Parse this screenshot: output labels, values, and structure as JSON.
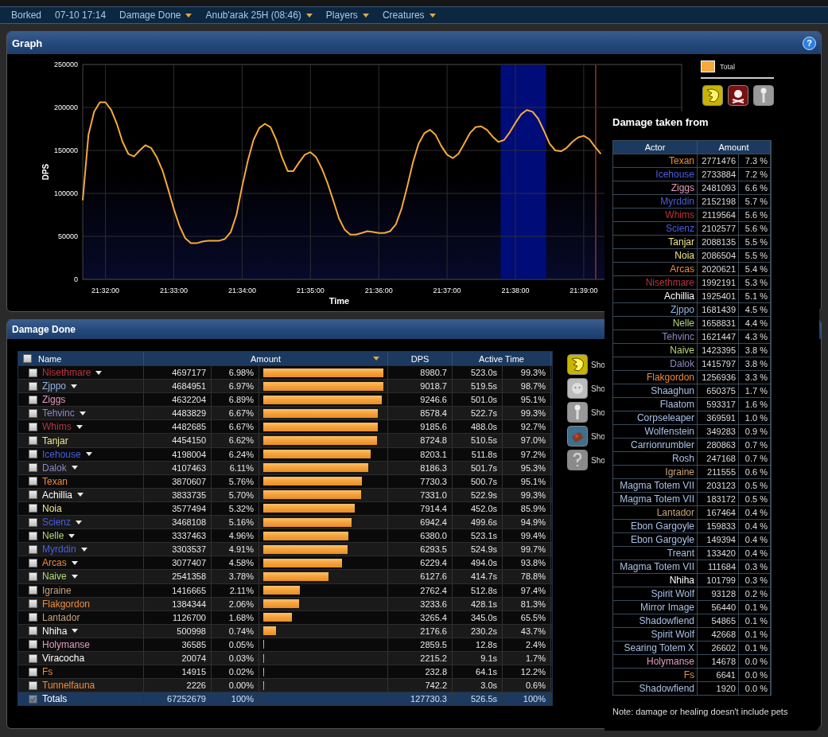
{
  "top_bar": {
    "items": [
      {
        "label": "Borked",
        "menu": false
      },
      {
        "label": "07-10 17:14",
        "menu": false
      },
      {
        "label": "Damage Done",
        "menu": true
      },
      {
        "label": "Anub'arak 25H (08:46)",
        "menu": true
      },
      {
        "label": "Players",
        "menu": true
      },
      {
        "label": "Creatures",
        "menu": true
      }
    ]
  },
  "graph_panel": {
    "title": "Graph",
    "help": "?",
    "chart_data": {
      "type": "line",
      "xlabel": "Time",
      "ylabel": "DPS",
      "ylim": [
        0,
        250000
      ],
      "yticks": [
        0,
        50000,
        100000,
        150000,
        200000,
        250000
      ],
      "categories": [
        null,
        null,
        null,
        null,
        "21:32:00",
        null,
        null,
        null,
        null,
        null,
        null,
        null,
        null,
        null,
        null,
        null,
        "21:33:00",
        null,
        null,
        null,
        null,
        null,
        null,
        null,
        null,
        null,
        null,
        null,
        "21:34:00",
        null,
        null,
        null,
        null,
        null,
        null,
        null,
        null,
        null,
        null,
        null,
        "21:35:00",
        null,
        null,
        null,
        null,
        null,
        null,
        null,
        null,
        null,
        null,
        null,
        "21:36:00",
        null,
        null,
        null,
        null,
        null,
        null,
        null,
        null,
        null,
        null,
        null,
        "21:37:00",
        null,
        null,
        null,
        null,
        null,
        null,
        null,
        null,
        null,
        null,
        null,
        "21:38:00",
        null,
        null,
        null,
        null,
        null,
        null,
        null,
        null,
        null,
        null,
        null,
        "21:39:00",
        null,
        null,
        null
      ],
      "series": [
        {
          "name": "Total",
          "color": "#f5a93a",
          "values": [
            92000,
            168000,
            195000,
            206000,
            206000,
            197000,
            181000,
            160000,
            146000,
            143000,
            150000,
            156000,
            153000,
            142000,
            127000,
            105000,
            82000,
            62000,
            48000,
            42000,
            42000,
            44000,
            45000,
            45000,
            45000,
            47000,
            55000,
            75000,
            108000,
            138000,
            162000,
            176000,
            181000,
            177000,
            162000,
            142000,
            126000,
            126000,
            136000,
            145000,
            148000,
            142000,
            129000,
            112000,
            92000,
            71000,
            58000,
            52000,
            52000,
            54000,
            56000,
            55000,
            54000,
            54000,
            56000,
            64000,
            82000,
            108000,
            136000,
            158000,
            170000,
            174000,
            168000,
            155000,
            145000,
            141000,
            146000,
            158000,
            170000,
            177000,
            178000,
            174000,
            166000,
            160000,
            162000,
            171000,
            182000,
            192000,
            197000,
            195000,
            187000,
            173000,
            158000,
            150000,
            149000,
            153000,
            160000,
            165000,
            167000,
            163000,
            154000,
            146000
          ]
        }
      ],
      "grid": true
    }
  },
  "damage_panel": {
    "title": "Damage Done",
    "table": {
      "columns": [
        "Name",
        "Amount",
        "DPS",
        "Active Time"
      ],
      "select_all": {
        "checked": false
      },
      "rows": [
        {
          "name": "Nisethmare",
          "color": "#b8333f",
          "menu": true,
          "checked": false,
          "amount": "4697177",
          "percent": "6.98%",
          "level": 1.0,
          "dps": "8980.7",
          "time": "523.0s",
          "active": "99.3%"
        },
        {
          "name": "Zjppo",
          "color": "#8fb5e8",
          "menu": true,
          "checked": false,
          "amount": "4684951",
          "percent": "6.97%",
          "level": 0.997,
          "dps": "9018.7",
          "time": "519.5s",
          "active": "98.7%"
        },
        {
          "name": "Ziggs",
          "color": "#e39bc0",
          "menu": false,
          "checked": false,
          "amount": "4632204",
          "percent": "6.89%",
          "level": 0.986,
          "dps": "9246.6",
          "time": "501.0s",
          "active": "95.1%"
        },
        {
          "name": "Tehvinc",
          "color": "#8e88c4",
          "menu": true,
          "checked": false,
          "amount": "4483829",
          "percent": "6.67%",
          "level": 0.955,
          "dps": "8578.4",
          "time": "522.7s",
          "active": "99.3%"
        },
        {
          "name": "Whims",
          "color": "#b8333f",
          "menu": true,
          "checked": false,
          "amount": "4482685",
          "percent": "6.67%",
          "level": 0.954,
          "dps": "9185.6",
          "time": "488.0s",
          "active": "92.7%"
        },
        {
          "name": "Tanjar",
          "color": "#f0e68c",
          "menu": false,
          "checked": false,
          "amount": "4454150",
          "percent": "6.62%",
          "level": 0.948,
          "dps": "8724.8",
          "time": "510.5s",
          "active": "97.0%"
        },
        {
          "name": "Icehouse",
          "color": "#4a5fe0",
          "menu": true,
          "checked": false,
          "amount": "4198004",
          "percent": "6.24%",
          "level": 0.894,
          "dps": "8203.1",
          "time": "511.8s",
          "active": "97.2%"
        },
        {
          "name": "Dalok",
          "color": "#8e88c4",
          "menu": true,
          "checked": false,
          "amount": "4107463",
          "percent": "6.11%",
          "level": 0.874,
          "dps": "8186.3",
          "time": "501.7s",
          "active": "95.3%"
        },
        {
          "name": "Texan",
          "color": "#f08a3c",
          "menu": false,
          "checked": false,
          "amount": "3870607",
          "percent": "5.76%",
          "level": 0.824,
          "dps": "7730.3",
          "time": "500.7s",
          "active": "95.1%"
        },
        {
          "name": "Achillia",
          "color": "#ffffff",
          "menu": true,
          "checked": false,
          "amount": "3833735",
          "percent": "5.70%",
          "level": 0.816,
          "dps": "7331.0",
          "time": "522.9s",
          "active": "99.3%"
        },
        {
          "name": "Noia",
          "color": "#f0e68c",
          "menu": false,
          "checked": false,
          "amount": "3577494",
          "percent": "5.32%",
          "level": 0.762,
          "dps": "7914.4",
          "time": "452.0s",
          "active": "85.9%"
        },
        {
          "name": "Scienz",
          "color": "#4a5fe0",
          "menu": true,
          "checked": false,
          "amount": "3468108",
          "percent": "5.16%",
          "level": 0.738,
          "dps": "6942.4",
          "time": "499.6s",
          "active": "94.9%"
        },
        {
          "name": "Nelle",
          "color": "#b5d67a",
          "menu": true,
          "checked": false,
          "amount": "3337463",
          "percent": "4.96%",
          "level": 0.711,
          "dps": "6380.0",
          "time": "523.1s",
          "active": "99.4%"
        },
        {
          "name": "Myrddin",
          "color": "#4a5fe0",
          "menu": true,
          "checked": false,
          "amount": "3303537",
          "percent": "4.91%",
          "level": 0.703,
          "dps": "6293.5",
          "time": "524.9s",
          "active": "99.7%"
        },
        {
          "name": "Arcas",
          "color": "#f08a3c",
          "menu": true,
          "checked": false,
          "amount": "3077407",
          "percent": "4.58%",
          "level": 0.655,
          "dps": "6229.4",
          "time": "494.0s",
          "active": "93.8%"
        },
        {
          "name": "Naive",
          "color": "#b5d67a",
          "menu": true,
          "checked": false,
          "amount": "2541358",
          "percent": "3.78%",
          "level": 0.541,
          "dps": "6127.6",
          "time": "414.7s",
          "active": "78.8%"
        },
        {
          "name": "Igraine",
          "color": "#c9a37a",
          "menu": false,
          "checked": false,
          "amount": "1416665",
          "percent": "2.11%",
          "level": 0.302,
          "dps": "2762.4",
          "time": "512.8s",
          "active": "97.4%"
        },
        {
          "name": "Flakgordon",
          "color": "#f08a3c",
          "menu": false,
          "checked": false,
          "amount": "1384344",
          "percent": "2.06%",
          "level": 0.295,
          "dps": "3233.6",
          "time": "428.1s",
          "active": "81.3%"
        },
        {
          "name": "Lantador",
          "color": "#c9a37a",
          "menu": false,
          "checked": false,
          "amount": "1126700",
          "percent": "1.68%",
          "level": 0.24,
          "dps": "3265.4",
          "time": "345.0s",
          "active": "65.5%"
        },
        {
          "name": "Nhiha",
          "color": "#ffffff",
          "menu": true,
          "checked": false,
          "amount": "500998",
          "percent": "0.74%",
          "level": 0.107,
          "dps": "2176.6",
          "time": "230.2s",
          "active": "43.7%"
        },
        {
          "name": "Holymanse",
          "color": "#e39bc0",
          "menu": false,
          "checked": false,
          "amount": "36585",
          "percent": "0.05%",
          "level": 0.008,
          "dps": "2859.5",
          "time": "12.8s",
          "active": "2.4%"
        },
        {
          "name": "Viracocha",
          "color": "#ffffff",
          "menu": false,
          "checked": false,
          "amount": "20074",
          "percent": "0.03%",
          "level": 0.004,
          "dps": "2215.2",
          "time": "9.1s",
          "active": "1.7%"
        },
        {
          "name": "Fs",
          "color": "#f08a3c",
          "menu": false,
          "checked": false,
          "amount": "14915",
          "percent": "0.02%",
          "level": 0.003,
          "dps": "232.8",
          "time": "64.1s",
          "active": "12.2%"
        },
        {
          "name": "Tunnelfauna",
          "color": "#f08a3c",
          "menu": false,
          "checked": false,
          "amount": "2226",
          "percent": "0.00%",
          "level": 0.001,
          "dps": "742.2",
          "time": "3.0s",
          "active": "0.6%"
        }
      ],
      "totals": {
        "name": "Totals",
        "checked": true,
        "amount": "67252679",
        "percent": "100%",
        "dps": "127730.3",
        "time": "526.5s",
        "active": "100%"
      }
    },
    "filters": [
      {
        "kind": "claw",
        "label": "Sho"
      },
      {
        "kind": "face",
        "label": "Sho"
      },
      {
        "kind": "totem",
        "label": "Sho"
      },
      {
        "kind": "bag",
        "label": "Sho"
      },
      {
        "kind": "unknown",
        "label": "Sho"
      }
    ]
  },
  "tooltip": {
    "title": "Damage taken from",
    "columns": [
      "Actor",
      "Amount"
    ],
    "rows": [
      {
        "actor": "Texan",
        "color": "#f08a3c",
        "amount": "2771476",
        "percent": "7.3 %"
      },
      {
        "actor": "Icehouse",
        "color": "#4a5fe0",
        "amount": "2733884",
        "percent": "7.2 %"
      },
      {
        "actor": "Ziggs",
        "color": "#e39bc0",
        "amount": "2481093",
        "percent": "6.6 %"
      },
      {
        "actor": "Myrddin",
        "color": "#4a5fe0",
        "amount": "2152198",
        "percent": "5.7 %"
      },
      {
        "actor": "Whims",
        "color": "#b8333f",
        "amount": "2119564",
        "percent": "5.6 %"
      },
      {
        "actor": "Scienz",
        "color": "#4a5fe0",
        "amount": "2102577",
        "percent": "5.6 %"
      },
      {
        "actor": "Tanjar",
        "color": "#f0e68c",
        "amount": "2088135",
        "percent": "5.5 %"
      },
      {
        "actor": "Noia",
        "color": "#f0e68c",
        "amount": "2086504",
        "percent": "5.5 %"
      },
      {
        "actor": "Arcas",
        "color": "#f08a3c",
        "amount": "2020621",
        "percent": "5.4 %"
      },
      {
        "actor": "Nisethmare",
        "color": "#b8333f",
        "amount": "1992191",
        "percent": "5.3 %"
      },
      {
        "actor": "Achillia",
        "color": "#ffffff",
        "amount": "1925401",
        "percent": "5.1 %"
      },
      {
        "actor": "Zjppo",
        "color": "#8fb5e8",
        "amount": "1681439",
        "percent": "4.5 %"
      },
      {
        "actor": "Nelle",
        "color": "#b5d67a",
        "amount": "1658831",
        "percent": "4.4 %"
      },
      {
        "actor": "Tehvinc",
        "color": "#8e88c4",
        "amount": "1621447",
        "percent": "4.3 %"
      },
      {
        "actor": "Naive",
        "color": "#b5d67a",
        "amount": "1423395",
        "percent": "3.8 %"
      },
      {
        "actor": "Dalok",
        "color": "#8e88c4",
        "amount": "1415797",
        "percent": "3.8 %"
      },
      {
        "actor": "Flakgordon",
        "color": "#f08a3c",
        "amount": "1256936",
        "percent": "3.3 %"
      },
      {
        "actor": "Shaaghun",
        "color": "#a8c0e8",
        "amount": "650375",
        "percent": "1.7 %"
      },
      {
        "actor": "Flaatom",
        "color": "#a8c0e8",
        "amount": "593317",
        "percent": "1.6 %"
      },
      {
        "actor": "Corpseleaper",
        "color": "#a8c0e8",
        "amount": "369591",
        "percent": "1.0 %"
      },
      {
        "actor": "Wolfenstein",
        "color": "#a8c0e8",
        "amount": "349283",
        "percent": "0.9 %"
      },
      {
        "actor": "Carrionrumbler",
        "color": "#a8c0e8",
        "amount": "280863",
        "percent": "0.7 %"
      },
      {
        "actor": "Rosh",
        "color": "#a8c0e8",
        "amount": "247168",
        "percent": "0.7 %"
      },
      {
        "actor": "Igraine",
        "color": "#c9a37a",
        "amount": "211555",
        "percent": "0.6 %"
      },
      {
        "actor": "Magma Totem VII",
        "color": "#a8c0e8",
        "amount": "203123",
        "percent": "0.5 %"
      },
      {
        "actor": "Magma Totem VII",
        "color": "#a8c0e8",
        "amount": "183172",
        "percent": "0.5 %"
      },
      {
        "actor": "Lantador",
        "color": "#c9a37a",
        "amount": "167464",
        "percent": "0.4 %"
      },
      {
        "actor": "Ebon Gargoyle",
        "color": "#a8c0e8",
        "amount": "159833",
        "percent": "0.4 %"
      },
      {
        "actor": "Ebon Gargoyle",
        "color": "#a8c0e8",
        "amount": "149394",
        "percent": "0.4 %"
      },
      {
        "actor": "Treant",
        "color": "#a8c0e8",
        "amount": "133420",
        "percent": "0.4 %"
      },
      {
        "actor": "Magma Totem VII",
        "color": "#a8c0e8",
        "amount": "111684",
        "percent": "0.3 %"
      },
      {
        "actor": "Nhiha",
        "color": "#ffffff",
        "amount": "101799",
        "percent": "0.3 %"
      },
      {
        "actor": "Spirit Wolf",
        "color": "#a8c0e8",
        "amount": "93128",
        "percent": "0.2 %"
      },
      {
        "actor": "Mirror Image",
        "color": "#a8c0e8",
        "amount": "56440",
        "percent": "0.1 %"
      },
      {
        "actor": "Shadowfiend",
        "color": "#a8c0e8",
        "amount": "54865",
        "percent": "0.1 %"
      },
      {
        "actor": "Spirit Wolf",
        "color": "#a8c0e8",
        "amount": "42668",
        "percent": "0.1 %"
      },
      {
        "actor": "Searing Totem X",
        "color": "#a8c0e8",
        "amount": "26602",
        "percent": "0.1 %"
      },
      {
        "actor": "Holymanse",
        "color": "#e39bc0",
        "amount": "14678",
        "percent": "0.0 %"
      },
      {
        "actor": "Fs",
        "color": "#f08a3c",
        "amount": "6641",
        "percent": "0.0 %"
      },
      {
        "actor": "Shadowfiend",
        "color": "#a8c0e8",
        "amount": "1920",
        "percent": "0.0 %"
      }
    ],
    "note": "Note: damage or healing doesn't include pets"
  }
}
